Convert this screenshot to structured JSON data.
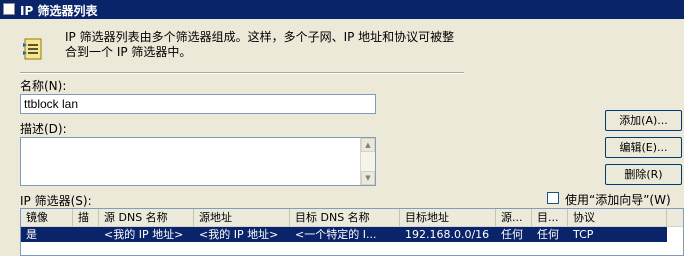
{
  "window": {
    "title": "IP 筛选器列表"
  },
  "header": {
    "description": "IP 筛选器列表由多个筛选器组成。这样，多个子网、IP 地址和协议可被整\n合到一个 IP 筛选器中。"
  },
  "form": {
    "name_label": "名称(N):",
    "name_value": "ttblock lan",
    "description_label": "描述(D):",
    "description_value": "",
    "filters_label": "IP 筛选器(S):",
    "use_wizard_label": "使用“添加向导”(W)",
    "use_wizard_checked": false
  },
  "buttons": {
    "add": "添加(A)...",
    "edit": "编辑(E)...",
    "remove": "删除(R)"
  },
  "table": {
    "columns": [
      "镜像",
      "描",
      "源 DNS 名称",
      "源地址",
      "目标 DNS 名称",
      "目标地址",
      "源...",
      "目...",
      "协议"
    ],
    "rows": [
      [
        "是",
        "",
        "<我的 IP 地址>",
        "<我的 IP 地址>",
        "<一个特定的 I...",
        "192.168.0.0/16",
        "任何",
        "任何",
        "TCP"
      ]
    ]
  }
}
